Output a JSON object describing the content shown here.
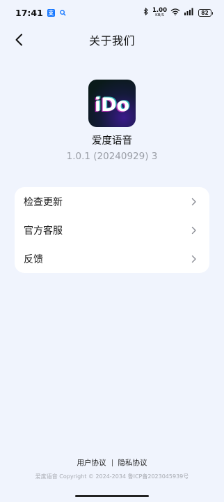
{
  "status_bar": {
    "time": "17:41",
    "alipay_icon_text": "支",
    "net_speed_value": "1.00",
    "net_speed_unit": "KB/S",
    "battery": "82"
  },
  "nav": {
    "title": "关于我们"
  },
  "app": {
    "logo_text": "iDo",
    "name": "爱度语音",
    "version": "1.0.1 (20240929) 3"
  },
  "menu": {
    "items": [
      {
        "label": "检查更新"
      },
      {
        "label": "官方客服"
      },
      {
        "label": "反馈"
      }
    ]
  },
  "footer": {
    "user_agreement": "用户协议",
    "privacy_agreement": "隐私协议",
    "copyright": "爱度语音 Copyright © 2024-2034 鲁ICP备2023045939号"
  },
  "colors": {
    "background": "#f0f4fd",
    "card": "#ffffff",
    "secondary_text": "#9a9ea6"
  }
}
